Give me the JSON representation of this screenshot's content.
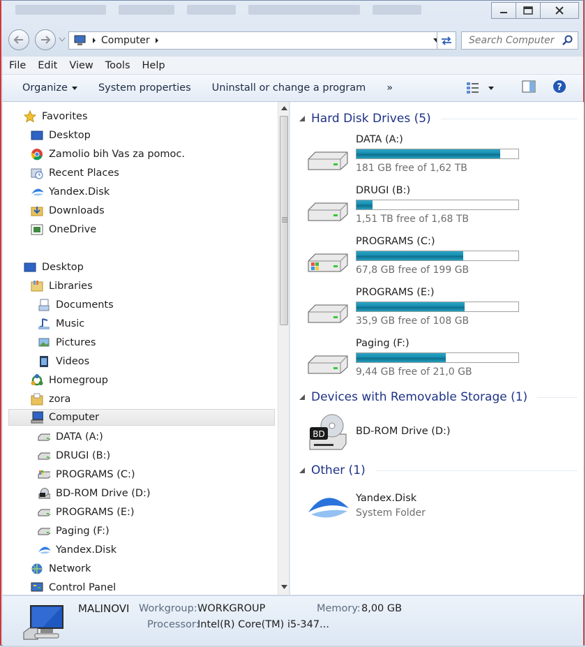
{
  "window": {
    "minimize": "—",
    "maximize": "▢",
    "close": "✕"
  },
  "address": {
    "location": "Computer"
  },
  "search": {
    "placeholder": "Search Computer"
  },
  "menu": [
    "File",
    "Edit",
    "View",
    "Tools",
    "Help"
  ],
  "commands": {
    "organize": "Organize",
    "system_properties": "System properties",
    "uninstall": "Uninstall or change a program",
    "more": "»"
  },
  "nav": {
    "favorites": "Favorites",
    "fav_items": [
      "Desktop",
      "Zamolio bih Vas za pomoc.",
      "Recent Places",
      "Yandex.Disk",
      "Downloads",
      "OneDrive"
    ],
    "desktop": "Desktop",
    "libraries": "Libraries",
    "lib_items": [
      "Documents",
      "Music",
      "Pictures",
      "Videos"
    ],
    "homegroup": "Homegroup",
    "zora": "zora",
    "computer": "Computer",
    "drives": [
      "DATA (A:)",
      "DRUGI (B:)",
      "PROGRAMS (C:)",
      "BD-ROM Drive (D:)",
      "PROGRAMS (E:)",
      "Paging (F:)",
      "Yandex.Disk"
    ],
    "network": "Network",
    "control_panel": "Control Panel"
  },
  "groups": {
    "hdd": "Hard Disk Drives (5)",
    "removable": "Devices with Removable Storage (1)",
    "other": "Other (1)"
  },
  "drives": [
    {
      "name": "DATA (A:)",
      "free": "181 GB free of 1,62 TB",
      "used_fraction": 0.89
    },
    {
      "name": "DRUGI (B:)",
      "free": "1,51 TB free of 1,68 TB",
      "used_fraction": 0.1
    },
    {
      "name": "PROGRAMS (C:)",
      "free": "67,8 GB free of 199 GB",
      "used_fraction": 0.66
    },
    {
      "name": "PROGRAMS (E:)",
      "free": "35,9 GB free of 108 GB",
      "used_fraction": 0.67
    },
    {
      "name": "Paging (F:)",
      "free": "9,44 GB free of 21,0 GB",
      "used_fraction": 0.55
    }
  ],
  "removable": {
    "name": "BD-ROM Drive (D:)",
    "badge": "BD"
  },
  "other": {
    "name": "Yandex.Disk",
    "type": "System Folder"
  },
  "details": {
    "computer_name": "MALINOVI",
    "workgroup_label": "Workgroup:",
    "workgroup": "WORKGROUP",
    "memory_label": "Memory:",
    "memory": "8,00 GB",
    "processor_label": "Processor:",
    "processor": "Intel(R) Core(TM) i5-347..."
  },
  "colors": {
    "accent": "#1e3287",
    "bar": "#188cae",
    "selection": "#e6e6e6"
  }
}
